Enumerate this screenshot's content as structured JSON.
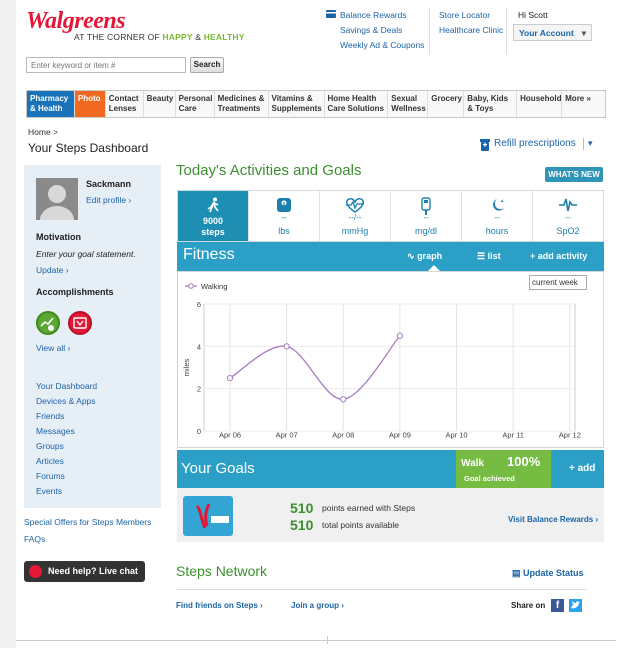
{
  "header": {
    "brand": "Walgreens",
    "tagline_prefix": "AT THE CORNER OF",
    "tagline_happy": "HAPPY",
    "tagline_amp": "&",
    "tagline_healthy": "HEALTHY",
    "links_col1": [
      "Balance Rewards",
      "Savings & Deals",
      "Weekly Ad & Coupons"
    ],
    "links_col2": [
      "Store Locator",
      "Healthcare Clinic"
    ],
    "greeting": "Hi Scott",
    "account_label": "Your Account",
    "search_placeholder": "Enter keyword or item #",
    "search_button": "Search"
  },
  "nav": [
    {
      "label": "Pharmacy & Health",
      "style": "blue"
    },
    {
      "label": "Photo",
      "style": "orange"
    },
    {
      "label": "Contact Lenses"
    },
    {
      "label": "Beauty"
    },
    {
      "label": "Personal Care"
    },
    {
      "label": "Medicines & Treatments"
    },
    {
      "label": "Vitamins & Supplements"
    },
    {
      "label": "Home Health Care Solutions"
    },
    {
      "label": "Sexual Wellness"
    },
    {
      "label": "Grocery"
    },
    {
      "label": "Baby, Kids & Toys"
    },
    {
      "label": "Household"
    },
    {
      "label": "More »"
    }
  ],
  "breadcrumb": "Home >",
  "page_title": "Your Steps Dashboard",
  "refill": "Refill prescriptions",
  "sidebar": {
    "username": "Sackmann",
    "edit_profile": "Edit profile ›",
    "motivation_title": "Motivation",
    "motivation_text": "Enter your goal statement.",
    "update": "Update ›",
    "accomplishments_title": "Accomplishments",
    "view_all": "View all ›",
    "dashboard": "Your Dashboard",
    "links": [
      "Devices & Apps",
      "Friends",
      "Messages",
      "Groups",
      "Articles",
      "Forums",
      "Events"
    ],
    "special_offers": "Special Offers for Steps Members",
    "faqs": "FAQs",
    "chat": "Need help? Live chat"
  },
  "main": {
    "heading": "Today's Activities and Goals",
    "whats_new": "WHAT'S NEW",
    "tabs": [
      {
        "value": "9000",
        "unit": "steps",
        "icon": "walking-icon",
        "active": true
      },
      {
        "value": "--",
        "unit": "lbs",
        "icon": "scale-icon"
      },
      {
        "value": "--/--",
        "unit": "mmHg",
        "icon": "heart-pulse-icon"
      },
      {
        "value": "--",
        "unit": "mg/dl",
        "icon": "glucose-meter-icon"
      },
      {
        "value": "--",
        "unit": "hours",
        "icon": "moon-stars-icon"
      },
      {
        "value": "--",
        "unit": "SpO2",
        "icon": "pulse-wave-icon"
      }
    ],
    "fitness_title": "Fitness",
    "graph_label": "graph",
    "list_label": "list",
    "add_activity": "add activity",
    "period_select": "current week",
    "goals_title": "Your Goals",
    "goal_activity": "Walk",
    "goal_percent": "100%",
    "goal_status": "Goal achieved",
    "add_goal": "add",
    "points_earned": "510",
    "points_earned_label": "points earned with Steps",
    "points_total": "510",
    "points_total_label": "total points available",
    "visit_rewards": "Visit Balance Rewards ›",
    "network_title": "Steps Network",
    "update_status": "Update Status",
    "find_friends": "Find friends on Steps ›",
    "join_group": "Join a group ›",
    "share_on": "Share on"
  },
  "chart_data": {
    "type": "line",
    "categories": [
      "Apr 06",
      "Apr 07",
      "Apr 08",
      "Apr 09",
      "Apr 10",
      "Apr 11",
      "Apr 12"
    ],
    "series": [
      {
        "name": "Walking",
        "values": [
          2.5,
          4.0,
          1.5,
          4.5,
          null,
          null,
          null
        ],
        "color": "#a57cc0"
      }
    ],
    "ylabel": "miles",
    "ylim": [
      0,
      6
    ],
    "yticks": [
      0,
      2,
      4,
      6
    ],
    "grid": true,
    "legend": "top-left"
  }
}
